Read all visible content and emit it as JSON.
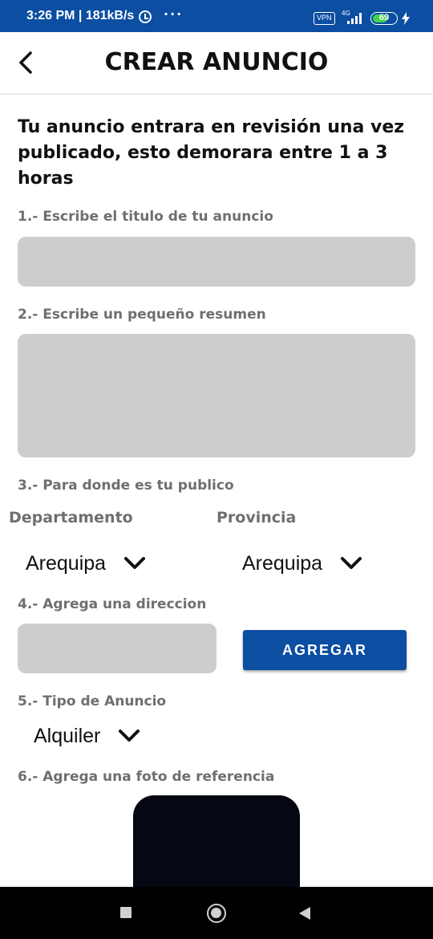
{
  "status_bar": {
    "time_speed": "3:26 PM | 181kB/s",
    "more": "···",
    "vpn": "VPN",
    "network": "4G",
    "battery_level": "69"
  },
  "app_bar": {
    "title": "CREAR ANUNCIO"
  },
  "form": {
    "intro": "Tu anuncio entrara en revisión una vez publicado, esto demorara entre 1 a 3 horas",
    "title_label": "1.- Escribe el titulo de tu anuncio",
    "title_value": "",
    "summary_label": "2.- Escribe un pequeño resumen",
    "summary_value": "",
    "audience_label": "3.- Para donde es tu publico",
    "department_label": "Departamento",
    "department_value": "Arequipa",
    "province_label": "Provincia",
    "province_value": "Arequipa",
    "address_label": "4.- Agrega una direccion",
    "address_value": "",
    "add_button": "AGREGAR",
    "type_label": "5.- Tipo de Anuncio",
    "type_value": "Alquiler",
    "photo_label": "6.- Agrega una foto de referencia"
  },
  "colors": {
    "primary": "#0b4ea2",
    "field_bg": "#cdcdcf",
    "label_gray": "#6f6f6f",
    "battery_green": "#3fd44a"
  },
  "icons": {
    "back": "back-arrow-icon",
    "dropdown": "chevron-down-icon",
    "alarm": "alarm-icon",
    "signal": "signal-icon",
    "battery": "battery-icon",
    "charging": "bolt-icon"
  }
}
